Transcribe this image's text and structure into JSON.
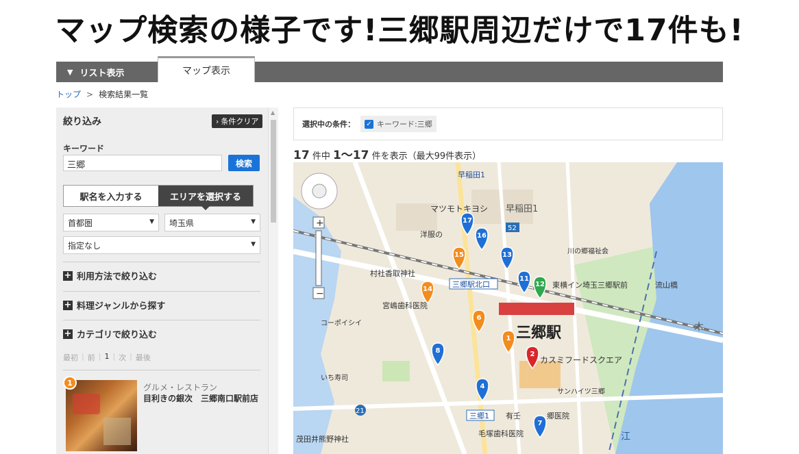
{
  "caption": "マップ検索の様子です!三郷駅周辺だけで17件も!",
  "tabs": {
    "list": "リスト表示",
    "map": "マップ表示"
  },
  "breadcrumb": {
    "home": "トップ",
    "sep": ">",
    "current": "検索結果一覧"
  },
  "sidebar": {
    "title": "絞り込み",
    "clear": "条件クリア",
    "keyword_label": "キーワード",
    "keyword_value": "三郷",
    "search": "検索",
    "station_tab": "駅名を入力する",
    "area_tab": "エリアを選択する",
    "region": "首都圏",
    "pref": "埼玉県",
    "city": "指定なし",
    "accordions": [
      "利用方法で絞り込む",
      "料理ジャンルから探す",
      "カテゴリで絞り込む"
    ],
    "pager": {
      "first": "最初",
      "prev": "前",
      "page": "1",
      "next": "次",
      "last": "最後"
    },
    "result": {
      "badge": "1",
      "genre": "グルメ・レストラン",
      "name": "目利きの銀次　三郷南口駅前店"
    }
  },
  "conditions": {
    "label": "選択中の条件：",
    "chip": "キーワード:三郷"
  },
  "count": {
    "total": "17",
    "mid": "件中",
    "range": "1〜17",
    "tail": "件を表示（最大99件表示）"
  },
  "map": {
    "labels": {
      "nishiwaseda": "早稲田1",
      "matsumoto": "マツモトキヨシ",
      "waseda1": "早稲田1",
      "kawanogo": "川の郷福祉会",
      "yofuku": "洋服の",
      "jinja": "村社香取神社",
      "kitaguchi": "三郷駅北口",
      "toyoko": "東横イン埼玉三郷駅前",
      "nagareyama": "流山橋",
      "miyajima": "宮嶋歯科医院",
      "coopy": "コーポイシイ",
      "station": "三郷駅",
      "kasumi": "カスミフードスクエア",
      "ichikawa": "いち寿司",
      "sunheights": "サンハイツ三郷",
      "misato1": "三郷1",
      "ariyama": "有壬",
      "kyouin": "郷医院",
      "mizuka": "毛塚歯科医院",
      "kashima": "茂田井熊野神社",
      "route52": "52",
      "route21": "21",
      "edo": "江",
      "tree": "木"
    },
    "pins": [
      {
        "n": "17",
        "color": "#1f6fd6"
      },
      {
        "n": "16",
        "color": "#1f6fd6"
      },
      {
        "n": "15",
        "color": "#f28c1e"
      },
      {
        "n": "13",
        "color": "#1f6fd6"
      },
      {
        "n": "14",
        "color": "#f28c1e"
      },
      {
        "n": "11",
        "color": "#1f6fd6"
      },
      {
        "n": "12",
        "color": "#2fa84f"
      },
      {
        "n": "6",
        "color": "#f28c1e"
      },
      {
        "n": "1",
        "color": "#f28c1e"
      },
      {
        "n": "2",
        "color": "#d9262a"
      },
      {
        "n": "8",
        "color": "#1f6fd6"
      },
      {
        "n": "4",
        "color": "#1f6fd6"
      },
      {
        "n": "7",
        "color": "#1f6fd6"
      }
    ]
  }
}
